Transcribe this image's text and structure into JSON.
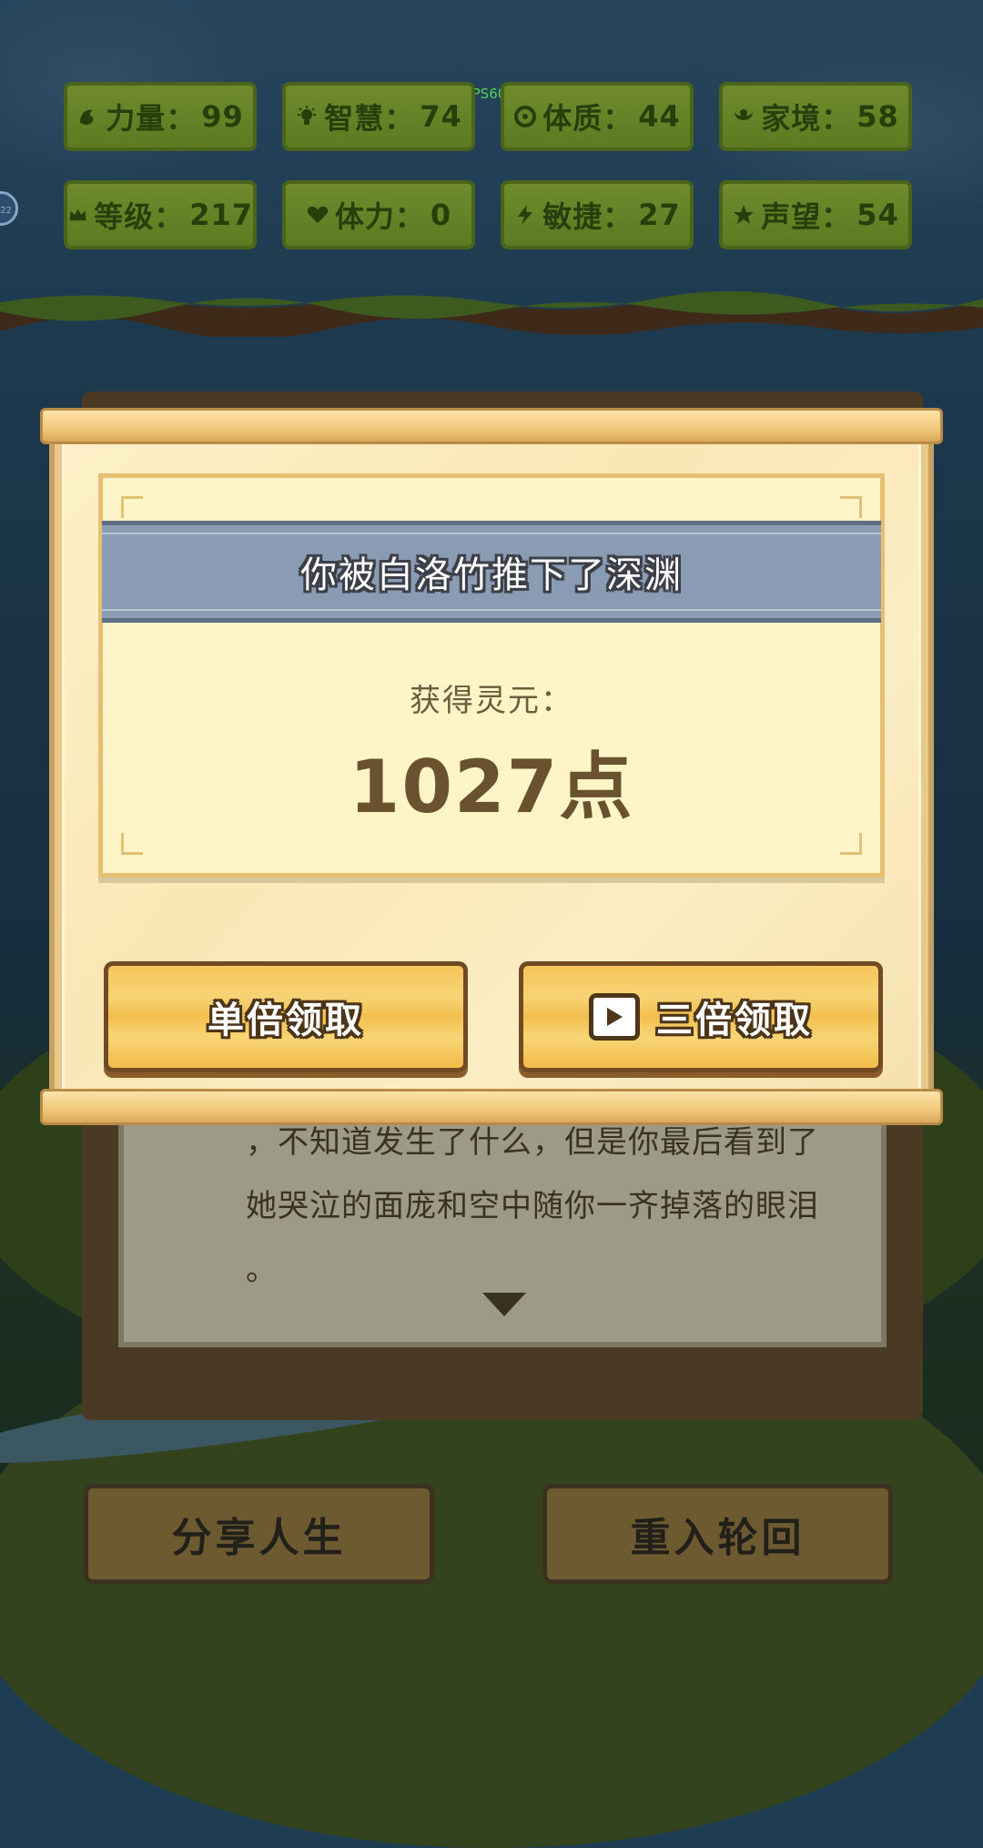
{
  "fps_label": "FPS60",
  "side_chip": "22",
  "stats": [
    {
      "icon": "strength-icon",
      "label": "力量：",
      "value": "99"
    },
    {
      "icon": "wisdom-icon",
      "label": "智慧：",
      "value": "74"
    },
    {
      "icon": "constitution-icon",
      "label": "体质：",
      "value": "44"
    },
    {
      "icon": "family-icon",
      "label": "家境：",
      "value": "58"
    },
    {
      "icon": "crown-icon",
      "label": "等级：",
      "value": "217"
    },
    {
      "icon": "heart-icon",
      "label": "体力：",
      "value": "0"
    },
    {
      "icon": "lightning-icon",
      "label": "敏捷：",
      "value": "27"
    },
    {
      "icon": "star-icon",
      "label": "声望：",
      "value": "54"
    }
  ],
  "story": {
    "line1": "，不知道发生了什么，但是你最后看到了",
    "line2": "她哭泣的面庞和空中随你一齐掉落的眼泪",
    "line3": "。"
  },
  "bottom_buttons": {
    "share": "分享人生",
    "reincarnate": "重入轮回"
  },
  "modal": {
    "title": "你被白洛竹推下了深渊",
    "reward_label": "获得灵元：",
    "reward_value": "1027点",
    "single_claim": "单倍领取",
    "triple_claim": "三倍领取"
  },
  "colors": {
    "stat_bg": "#6f8b2d",
    "banner": "#8a9cb3",
    "plank": "#f6c55b",
    "paper": "#fdf5c8"
  }
}
